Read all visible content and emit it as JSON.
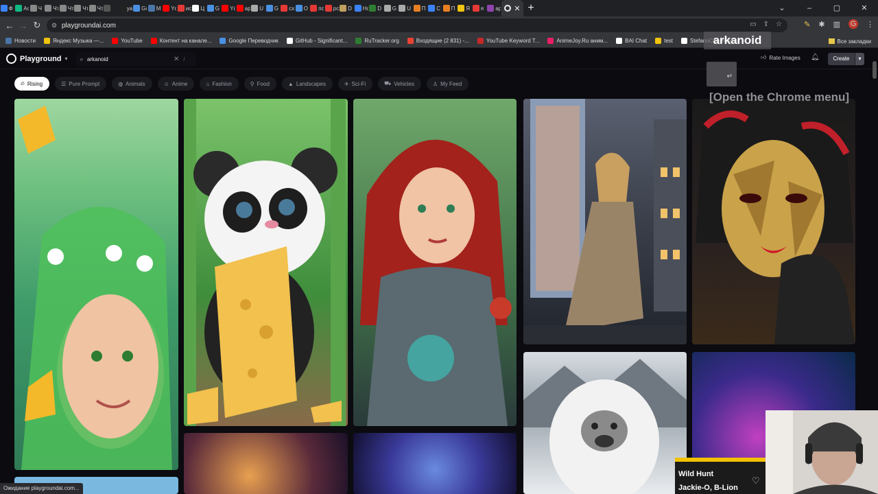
{
  "browser": {
    "tabs": [
      {
        "label": "Ф",
        "color": "#3b82f6"
      },
      {
        "label": "Ас",
        "color": "#10b981"
      },
      {
        "label": "Ч",
        "color": "#888888"
      },
      {
        "label": "Чт",
        "color": "#888888"
      },
      {
        "label": "Чт",
        "color": "#888888"
      },
      {
        "label": "Чт",
        "color": "#888888"
      },
      {
        "label": "Чт",
        "color": "#888888"
      },
      {
        "label": "",
        "color": "#555555"
      },
      {
        "label": "ya",
        "color": "#222222"
      },
      {
        "label": "Gc",
        "color": "#4a90e2"
      },
      {
        "label": "M",
        "color": "#4a76a8"
      },
      {
        "label": "Yc",
        "color": "#ff0000"
      },
      {
        "label": "ис",
        "color": "#e53935"
      },
      {
        "label": "Ц",
        "color": "#ffffff"
      },
      {
        "label": "G",
        "color": "#4a90e2"
      },
      {
        "label": "Yc",
        "color": "#ff0000"
      },
      {
        "label": "ар",
        "color": "#ff0000"
      },
      {
        "label": "U",
        "color": "#aaaaaa"
      },
      {
        "label": "G",
        "color": "#4a90e2"
      },
      {
        "label": "сх",
        "color": "#e53935"
      },
      {
        "label": "О",
        "color": "#4a90e2"
      },
      {
        "label": "пс",
        "color": "#e53935"
      },
      {
        "label": "рс",
        "color": "#e53935"
      },
      {
        "label": "D",
        "color": "#c0a060"
      },
      {
        "label": "Hc",
        "color": "#3b82f6"
      },
      {
        "label": "D",
        "color": "#2e7d32"
      },
      {
        "label": "G",
        "color": "#aaaaaa"
      },
      {
        "label": "U",
        "color": "#aaaaaa"
      },
      {
        "label": "П",
        "color": "#e67e22"
      },
      {
        "label": "С",
        "color": "#3b82f6"
      },
      {
        "label": "П",
        "color": "#e67e22"
      },
      {
        "label": "Я",
        "color": "#f1c40f"
      },
      {
        "label": "я",
        "color": "#e53935"
      },
      {
        "label": "ар",
        "color": "#8e44ad"
      }
    ],
    "active_tab_icon": "playground-icon",
    "url": "playgroundai.com",
    "profile_letter": "G"
  },
  "bookmarks": [
    {
      "label": "Новости",
      "color": "#4a76a8"
    },
    {
      "label": "Яндекс Музыка —...",
      "color": "#f1c40f"
    },
    {
      "label": "YouTube",
      "color": "#ff0000"
    },
    {
      "label": "Контент на канале...",
      "color": "#ff0000"
    },
    {
      "label": "Google Переводчик",
      "color": "#4a90e2"
    },
    {
      "label": "GitHub - Significant...",
      "color": "#ffffff"
    },
    {
      "label": "RuTracker.org",
      "color": "#2e7d32"
    },
    {
      "label": "Входящие (2 831) -...",
      "color": "#ea4335"
    },
    {
      "label": "YouTube Keyword T...",
      "color": "#c62828"
    },
    {
      "label": "AnimeJoy.Ru аним...",
      "color": "#e91e63"
    },
    {
      "label": "BAI Chat",
      "color": "#ffffff"
    },
    {
      "label": "test",
      "color": "#f1c40f"
    },
    {
      "label": "StefanoCecere/awe...",
      "color": "#ffffff"
    }
  ],
  "all_bookmarks_label": "Все закладки",
  "playground": {
    "logo_text": "Playground",
    "search_value": "arkanoid",
    "search_shortcut": "/",
    "rate_label": "Rate Images",
    "create_label": "Create",
    "chips": [
      {
        "label": "Rising",
        "icon": "flame-icon",
        "active": true
      },
      {
        "label": "Pure Prompt",
        "icon": "lines-icon",
        "active": false
      },
      {
        "label": "Animals",
        "icon": "paw-icon",
        "active": false
      },
      {
        "label": "Anime",
        "icon": "face-icon",
        "active": false
      },
      {
        "label": "Fashion",
        "icon": "hanger-icon",
        "active": false
      },
      {
        "label": "Food",
        "icon": "fork-icon",
        "active": false
      },
      {
        "label": "Landscapes",
        "icon": "mountain-icon",
        "active": false
      },
      {
        "label": "Sci-Fi",
        "icon": "rocket-icon",
        "active": false
      },
      {
        "label": "Vehicles",
        "icon": "car-icon",
        "active": false
      },
      {
        "label": "My Feed",
        "icon": "user-icon",
        "active": false
      }
    ]
  },
  "overlays": {
    "caption_top": "arkanoid",
    "caption_menu": "[Open the Chrome menu]",
    "enter_key": "↵"
  },
  "status_text": "Ожидание playgroundai.com...",
  "now_playing": {
    "title": "Wild Hunt",
    "artist": "Jackie-O, B-Lion"
  }
}
